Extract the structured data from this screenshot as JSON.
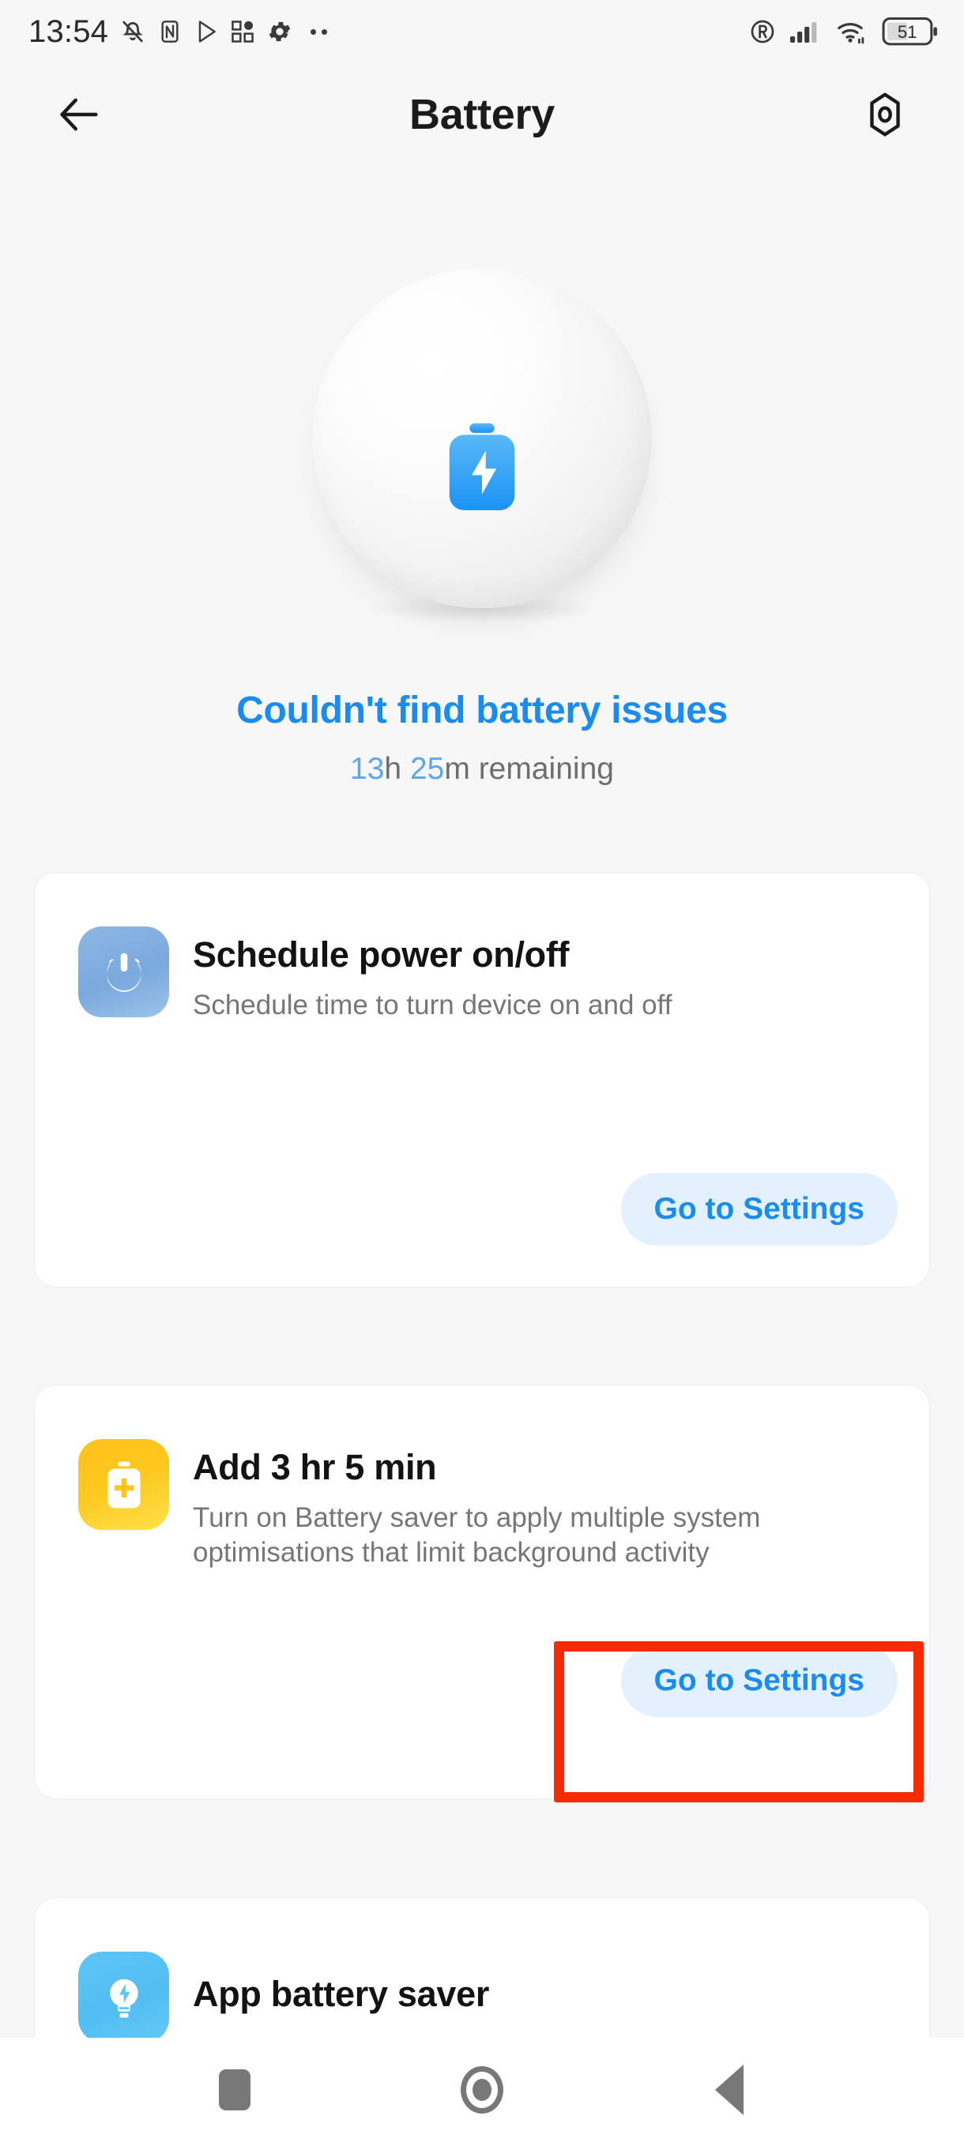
{
  "statusbar": {
    "clock": "13:54",
    "left_icons": [
      "mute-bell-icon",
      "nfc-icon",
      "play-store-icon",
      "app-grid-icon",
      "gear-icon",
      "more-dots-icon"
    ],
    "right_icons": [
      "registered-r-icon",
      "cellular-signal-icon",
      "wifi-icon"
    ],
    "battery_percent": "51"
  },
  "header": {
    "back_icon": "back-arrow-icon",
    "title": "Battery",
    "settings_icon": "hex-settings-icon"
  },
  "hero": {
    "illustration": "battery-sphere-illustration",
    "battery_icon": "battery-bolt-icon",
    "status_headline": "Couldn't find battery issues",
    "remaining_hours": "13",
    "remaining_hours_unit": "h",
    "remaining_minutes": "25",
    "remaining_minutes_unit": "m",
    "remaining_suffix": " remaining"
  },
  "cards": [
    {
      "icon": "power-button-icon",
      "title": "Schedule power on/off",
      "description": "Schedule time to turn device on and off",
      "cta": "Go to Settings"
    },
    {
      "icon": "battery-plus-icon",
      "title": "Add 3 hr 5 min",
      "description": "Turn on Battery saver to apply multiple system optimisations that limit background activity",
      "cta": "Go to Settings"
    },
    {
      "icon": "bulb-bolt-icon",
      "title": "App battery saver",
      "description": "",
      "cta": ""
    }
  ],
  "highlight": {
    "target": "go-to-settings-button-card-2",
    "color": "#f62b03"
  },
  "navbar": {
    "recents_icon": "square-recents-icon",
    "home_icon": "circle-home-icon",
    "back_icon": "triangle-back-icon"
  },
  "colors": {
    "accent_blue": "#1a8cf0",
    "background": "#f7f7f7",
    "card": "#ffffff",
    "cta_bg": "#e3f0fd",
    "highlight_red": "#f62b03"
  }
}
